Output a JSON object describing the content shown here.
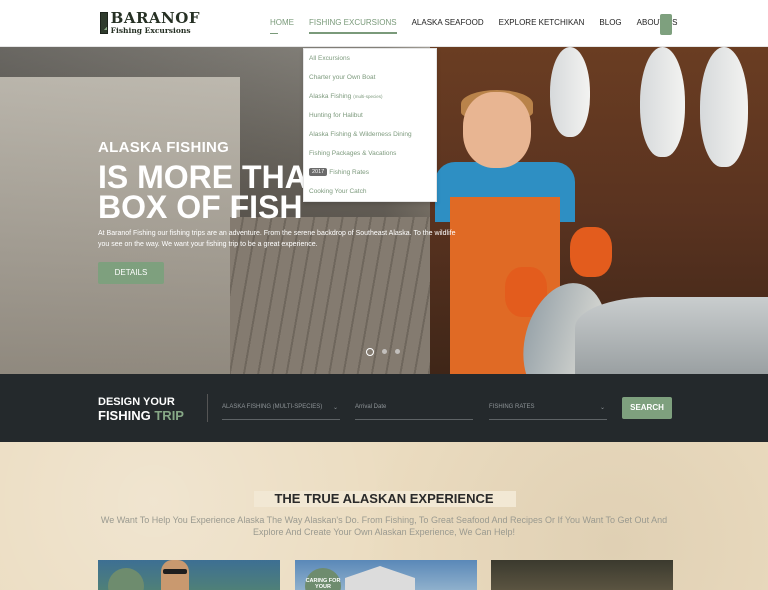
{
  "logo": {
    "title": "BARANOF",
    "subtitle": "Fishing Excursions"
  },
  "nav": {
    "items": [
      {
        "label": "HOME"
      },
      {
        "label": "FISHING EXCURSIONS"
      },
      {
        "label": "ALASKA SEAFOOD"
      },
      {
        "label": "EXPLORE KETCHIKAN"
      },
      {
        "label": "BLOG"
      },
      {
        "label": "ABOUT US"
      }
    ]
  },
  "dropdown": {
    "items": [
      {
        "label": "All Excursions"
      },
      {
        "label": "Charter your Own Boat"
      },
      {
        "label": "Alaska Fishing",
        "small": "(multi-species)"
      },
      {
        "label": "Hunting for Halibut"
      },
      {
        "label": "Alaska Fishing & Wilderness Dining"
      },
      {
        "label": "Fishing Packages & Vacations"
      },
      {
        "label": "Fishing Rates",
        "badge": "2017"
      },
      {
        "label": "Cooking Your Catch"
      }
    ]
  },
  "hero": {
    "kicker": "ALASKA FISHING",
    "title": "IS MORE THAN A\nBOX OF FISH",
    "description": "At Baranof Fishing our fishing trips are an adventure. From the serene backdrop of Southeast Alaska. To the wildlife you see on the way. We want your fishing trip to be a great experience.",
    "button": "DETAILS",
    "slides_total": 3,
    "active_slide": 1
  },
  "design": {
    "title_line1": "DESIGN YOUR",
    "title_word": "FISHING",
    "title_accent": "TRIP",
    "trip_select": "ALASKA FISHING (MULTI-SPECIES)",
    "arrival_placeholder": "Arrival Date",
    "rates_select": "FISHING RATES",
    "search_button": "SEARCH"
  },
  "experience": {
    "title": "THE TRUE ALASKAN EXPERIENCE",
    "subtitle": "We Want To Help You Experience Alaska The Way Alaskan's Do. From Fishing, To Great Seafood And Recipes Or If You Want To Get Out And Explore And Create Your Own Alaskan Experience, We Can Help!",
    "card2_badge": "CARING FOR YOUR"
  },
  "colors": {
    "accent_green": "#7ea07e",
    "dark_bar": "#24292c",
    "sand": "#ebdcc0"
  }
}
